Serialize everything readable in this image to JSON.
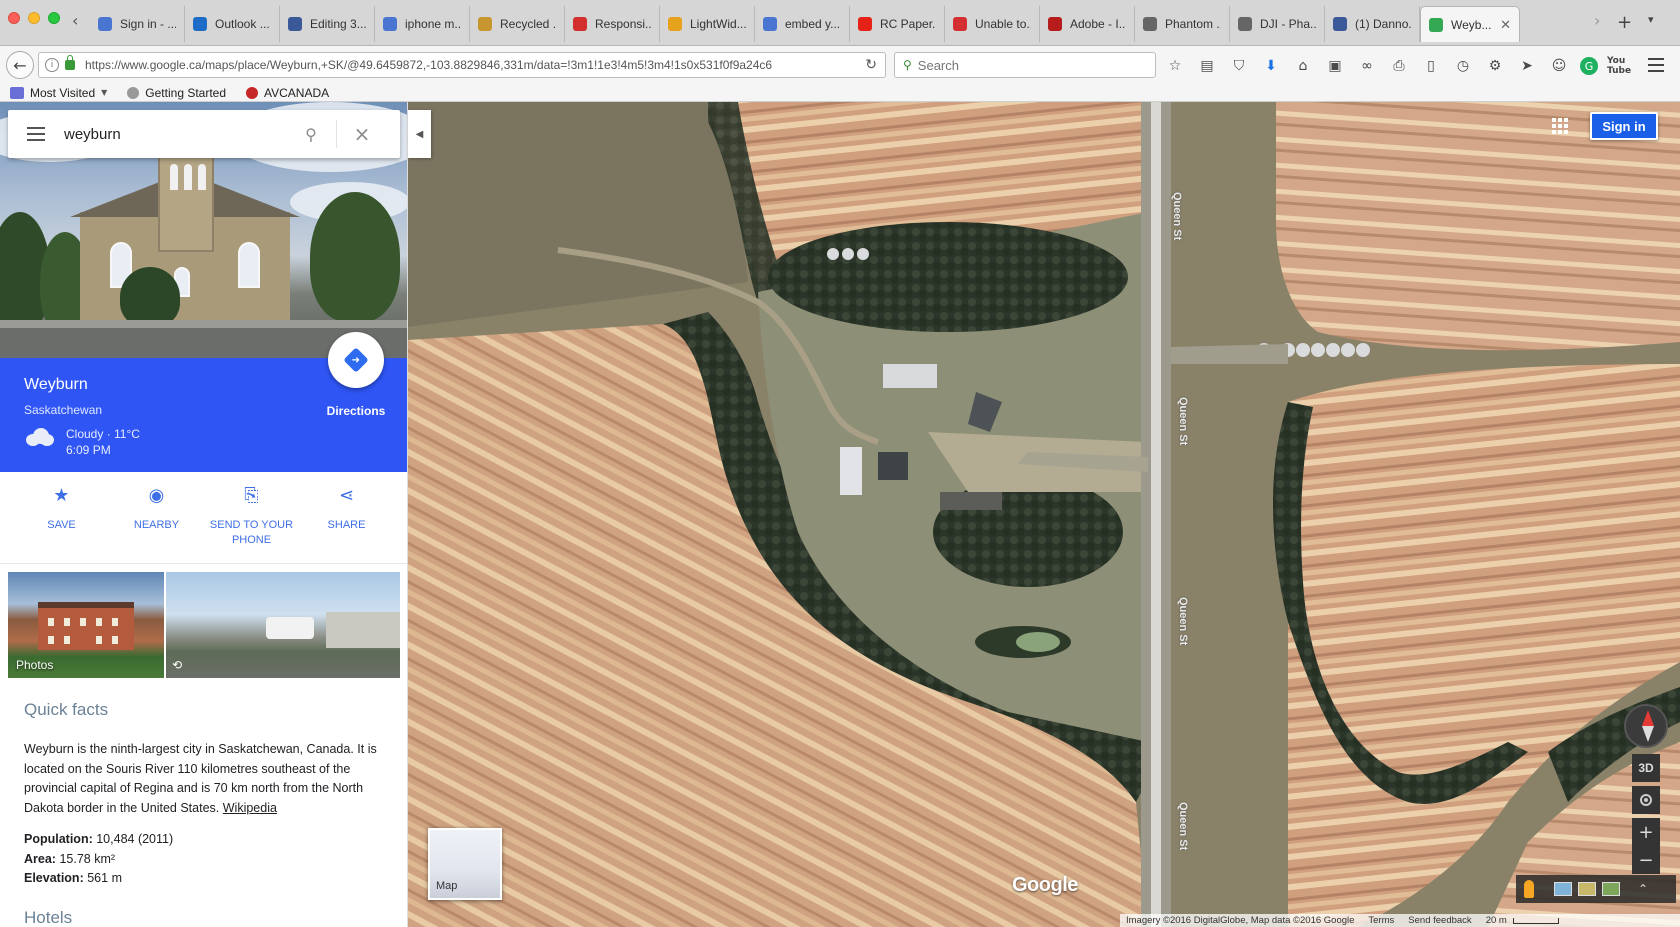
{
  "browser": {
    "tabs": [
      {
        "label": "Sign in - ...",
        "icon": "google-tab-icon",
        "color": "#4a76d1"
      },
      {
        "label": "Outlook ...",
        "icon": "outlook-tab-icon",
        "color": "#1f6cc7"
      },
      {
        "label": "Editing 3...",
        "icon": "facebook-tab-icon",
        "color": "#3b5998"
      },
      {
        "label": "iphone m...",
        "icon": "google-tab-icon",
        "color": "#4a76d1"
      },
      {
        "label": "Recycled ...",
        "icon": "store-tab-icon",
        "color": "#c8962e"
      },
      {
        "label": "Responsi...",
        "icon": "adobe-tab-icon",
        "color": "#d32f2f"
      },
      {
        "label": "LightWid...",
        "icon": "lightwidget-tab-icon",
        "color": "#e6a21c"
      },
      {
        "label": "embed y...",
        "icon": "google-tab-icon",
        "color": "#4a76d1"
      },
      {
        "label": "RC Paper...",
        "icon": "youtube-tab-icon",
        "color": "#e62117"
      },
      {
        "label": "Unable to...",
        "icon": "adobe-tab-icon",
        "color": "#d32f2f"
      },
      {
        "label": "Adobe - I...",
        "icon": "adobe-tab-icon",
        "color": "#b71c1c"
      },
      {
        "label": "Phantom ...",
        "icon": "dji-tab-icon",
        "color": "#666666"
      },
      {
        "label": "DJI - Pha...",
        "icon": "dji-tab-icon",
        "color": "#666666"
      },
      {
        "label": "(1) Danno...",
        "icon": "facebook-tab-icon",
        "color": "#3b5998"
      },
      {
        "label": "Weyb...",
        "icon": "maps-tab-icon",
        "color": "#34a853"
      }
    ],
    "url": "https://www.google.ca/maps/place/Weyburn,+SK/@49.6459872,-103.8829846,331m/data=!3m1!1e3!4m5!3m4!1s0x531f0f9a24c6",
    "search_placeholder": "Search",
    "bookmarks": {
      "most_visited": "Most Visited",
      "getting_started": "Getting Started",
      "avcanada": "AVCANADA"
    }
  },
  "search": {
    "query": "weyburn"
  },
  "place": {
    "name": "Weyburn",
    "region": "Saskatchewan",
    "weather": "Cloudy · 11°C",
    "time": "6:09 PM",
    "directions_label": "Directions",
    "actions": [
      {
        "icon": "star-icon",
        "glyph": "★",
        "label": "SAVE"
      },
      {
        "icon": "nearby-icon",
        "glyph": "◉",
        "label": "NEARBY"
      },
      {
        "icon": "send-to-phone-icon",
        "glyph": "⎘",
        "label": "SEND TO YOUR PHONE"
      },
      {
        "icon": "share-icon",
        "glyph": "⋖",
        "label": "SHARE"
      }
    ],
    "photos_label": "Photos",
    "quick_facts_title": "Quick facts",
    "description": "Weyburn is the ninth-largest city in Saskatchewan, Canada. It is located on the Souris River 110 kilometres southeast of the provincial capital of Regina and is 70 km north from the North Dakota border in the United States.",
    "wikipedia_link": "Wikipedia",
    "facts": {
      "population_label": "Population:",
      "population_value": "10,484 (2011)",
      "area_label": "Area:",
      "area_value": "15.78 km²",
      "elevation_label": "Elevation:",
      "elevation_value": "561 m"
    },
    "hotels_title": "Hotels"
  },
  "map": {
    "sign_in": "Sign in",
    "road_name": "Queen St",
    "layer_label": "Map",
    "logo": "Google",
    "controls": {
      "three_d": "3D",
      "zoom_in": "+",
      "zoom_out": "−"
    },
    "attribution": {
      "imagery": "Imagery ©2016 DigitalGlobe, Map data ©2016 Google",
      "terms": "Terms",
      "feedback": "Send feedback",
      "scale": "20 m"
    }
  }
}
